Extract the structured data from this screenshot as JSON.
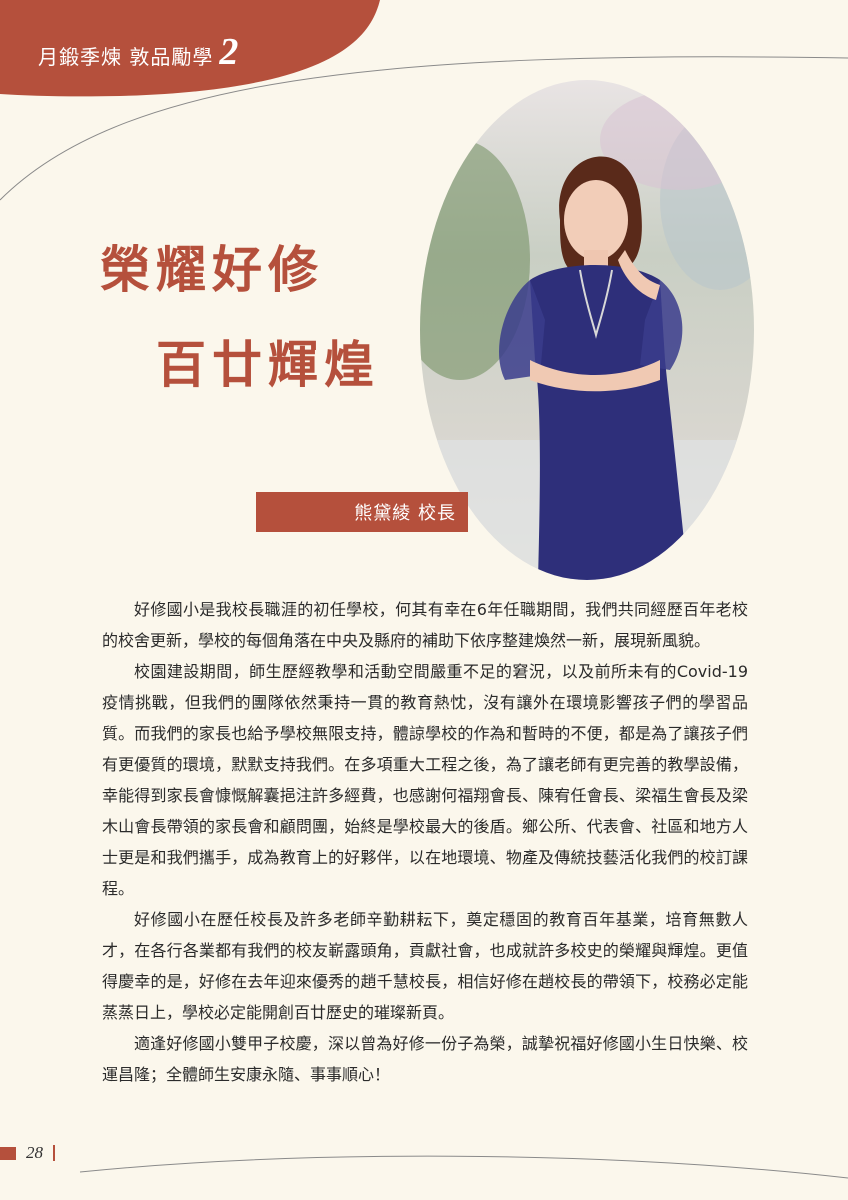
{
  "header": {
    "series": "月鍛季煉 敦品勵學",
    "issue_number": "2"
  },
  "title": {
    "line1": "榮耀好修",
    "line2": "百廿輝煌"
  },
  "name_tag": "熊黛綾 校長",
  "photo": {
    "description": "principal-portrait"
  },
  "paragraphs": [
    "好修國小是我校長職涯的初任學校，何其有幸在6年任職期間，我們共同經歷百年老校的校舍更新，學校的每個角落在中央及縣府的補助下依序整建煥然一新，展現新風貌。",
    "校園建設期間，師生歷經教學和活動空間嚴重不足的窘況，以及前所未有的Covid-19疫情挑戰，但我們的團隊依然秉持一貫的教育熱忱，沒有讓外在環境影響孩子們的學習品質。而我們的家長也給予學校無限支持，體諒學校的作為和暫時的不便，都是為了讓孩子們有更優質的環境，默默支持我們。在多項重大工程之後，為了讓老師有更完善的教學設備，幸能得到家長會慷慨解囊挹注許多經費，也感謝何福翔會長、陳宥任會長、梁福生會長及梁木山會長帶領的家長會和顧問團，始終是學校最大的後盾。鄉公所、代表會、社區和地方人士更是和我們攜手，成為教育上的好夥伴，以在地環境、物產及傳統技藝活化我們的校訂課程。",
    "好修國小在歷任校長及許多老師辛勤耕耘下，奠定穩固的教育百年基業，培育無數人才，在各行各業都有我們的校友嶄露頭角，貢獻社會，也成就許多校史的榮耀與輝煌。更值得慶幸的是，好修在去年迎來優秀的趙千慧校長，相信好修在趙校長的帶領下，校務必定能蒸蒸日上，學校必定能開創百廿歷史的璀璨新頁。",
    "適逢好修國小雙甲子校慶，深以曾為好修一份子為榮，誠摯祝福好修國小生日快樂、校運昌隆；全體師生安康永隨、事事順心！"
  ],
  "footer": {
    "page_number": "28"
  },
  "colors": {
    "accent": "#b5503c",
    "paper": "#fbf7ec"
  }
}
